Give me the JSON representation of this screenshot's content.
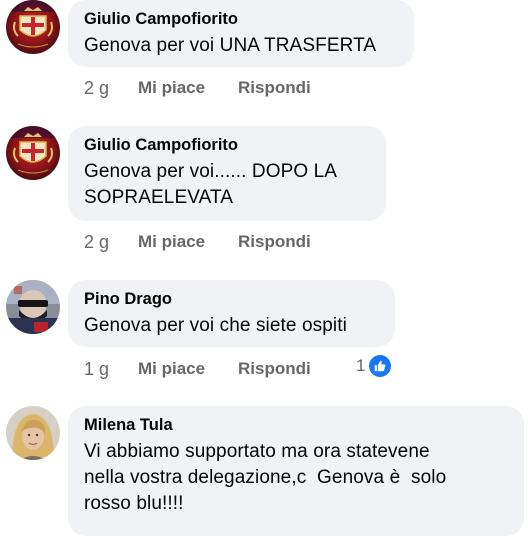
{
  "comments": [
    {
      "author": "Giulio Campofiorito",
      "text": "Genova per voi UNA TRASFERTA",
      "age": "2 g",
      "like_label": "Mi piace",
      "reply_label": "Rispondi",
      "avatar_icon": "red-crest-emblem"
    },
    {
      "author": "Giulio Campofiorito",
      "text_line1": "Genova per voi...... DOPO LA",
      "text_line2": "SOPRAELEVATA",
      "age": "2 g",
      "like_label": "Mi piace",
      "reply_label": "Rispondi",
      "avatar_icon": "red-crest-emblem"
    },
    {
      "author": "Pino Drago",
      "text": "Genova per voi che siete ospiti",
      "age": "1 g",
      "like_label": "Mi piace",
      "reply_label": "Rispondi",
      "reaction_count": "1",
      "avatar_icon": "masked-face-photo"
    },
    {
      "author": "Milena Tula",
      "text_line1": "Vi abbiamo supportato ma ora statevene",
      "text_line2": "nella vostra delegazione,c  Genova è  solo",
      "text_line3": "rosso blu!!!!",
      "avatar_icon": "blonde-woman-photo"
    }
  ],
  "colors": {
    "bubble": "#f0f2f5",
    "meta_text": "#65676b",
    "like_blue": "#1877f2"
  }
}
